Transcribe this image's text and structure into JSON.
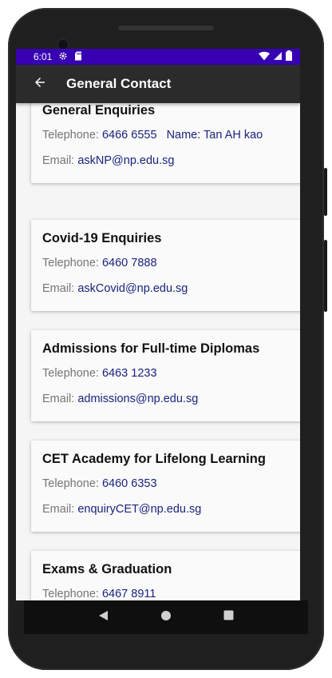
{
  "status_bar": {
    "time": "6:01",
    "background_color": "#3700b3",
    "icons": [
      "settings-icon",
      "sd-card-icon",
      "wifi-icon",
      "signal-icon",
      "battery-icon"
    ]
  },
  "app_bar": {
    "title": "General Contact",
    "back_icon": "arrow-back-icon"
  },
  "labels": {
    "telephone": "Telephone:",
    "email": "Email:"
  },
  "cards": [
    {
      "title": "General Enquiries",
      "telephone": "6466 6555",
      "name": "Name: Tan AH kao",
      "email": "askNP@np.edu.sg"
    },
    {
      "title": "Covid-19 Enquiries",
      "telephone": "6460 7888",
      "email": "askCovid@np.edu.sg"
    },
    {
      "title": "Admissions for Full-time Diplomas",
      "telephone": "6463 1233",
      "email": "admissions@np.edu.sg"
    },
    {
      "title": "CET Academy for Lifelong Learning",
      "telephone": "6460 6353",
      "email": "enquiryCET@np.edu.sg"
    },
    {
      "title": "Exams & Graduation",
      "telephone": "6467 8911"
    }
  ],
  "nav_bar": {
    "icons": [
      "back-triangle-icon",
      "home-circle-icon",
      "recents-square-icon"
    ]
  },
  "colors": {
    "app_bar": "#2b2b2b",
    "value_text": "#1a237e",
    "label_text": "#757575"
  }
}
